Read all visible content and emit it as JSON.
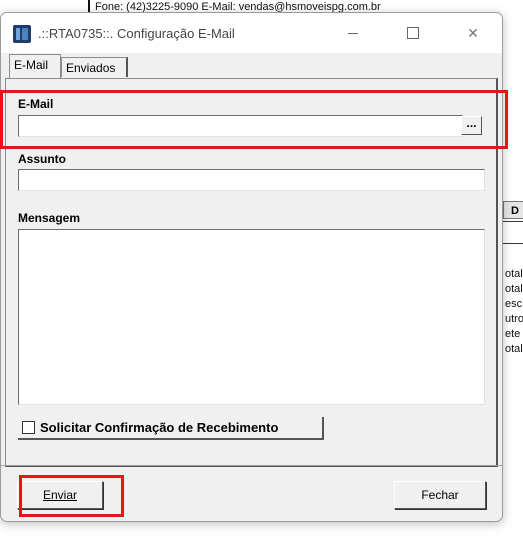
{
  "background": {
    "header_text": "Fone: (42)3225-9090 E-Mail: vendas@hsmoveispg.com.br",
    "table_header": "D",
    "rows": [
      "otal",
      "otal",
      "esc",
      "utro",
      "ete",
      "otal"
    ]
  },
  "window": {
    "title": ".::RTA0735::. Configuração E-Mail",
    "min_glyph": "—",
    "close_glyph": "✕"
  },
  "tabs": [
    {
      "label": "E-Mail",
      "active": true
    },
    {
      "label": "Enviados",
      "active": false
    }
  ],
  "form": {
    "email_label": "E-Mail",
    "email_value": "",
    "email_button_label": "...",
    "subject_label": "Assunto",
    "subject_value": "",
    "message_label": "Mensagem",
    "message_value": "",
    "confirm_label": "Solicitar Confirmação de Recebimento",
    "confirm_checked": false
  },
  "buttons": {
    "send_label": "Enviar",
    "close_label": "Fechar"
  },
  "colors": {
    "highlight": "#e8141a",
    "dialog_bg": "#f0f0f0"
  }
}
